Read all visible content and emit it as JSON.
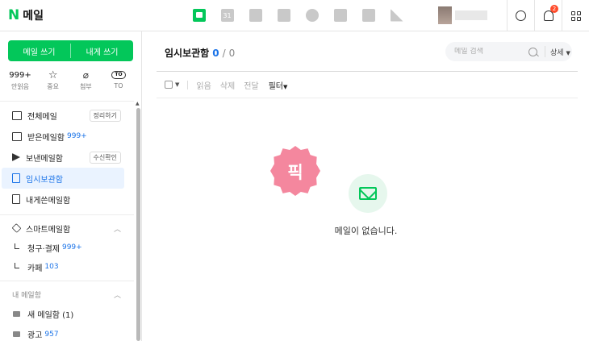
{
  "header": {
    "logo_letter": "N",
    "logo_text": "메일",
    "apps": [
      {
        "icon": "mail-icon",
        "active": true
      },
      {
        "icon": "calendar-icon",
        "label": "31"
      },
      {
        "icon": "photo-icon"
      },
      {
        "icon": "contacts-icon"
      },
      {
        "icon": "hexagon-icon"
      },
      {
        "icon": "memo-icon"
      },
      {
        "icon": "cafe-icon"
      },
      {
        "icon": "flag-icon"
      }
    ],
    "notification_count": "2",
    "accent_color": "#03c75a"
  },
  "sidebar": {
    "compose_label": "메일 쓰기",
    "self_compose_label": "내게 쓰기",
    "quick": [
      {
        "value": "999+",
        "label": "안읽음"
      },
      {
        "icon": "star-icon",
        "label": "중요"
      },
      {
        "icon": "paperclip-icon",
        "label": "첨부"
      },
      {
        "icon": "to-icon",
        "icon_text": "TO",
        "label": "TO"
      }
    ],
    "mailboxes": [
      {
        "label": "전체메일",
        "pill": "정리하기"
      },
      {
        "label": "받은메일함",
        "count": "999+"
      },
      {
        "label": "보낸메일함",
        "pill": "수신확인"
      },
      {
        "label": "임시보관함",
        "active": true
      },
      {
        "label": "내게쓴메일함"
      }
    ],
    "smart_section": "스마트메일함",
    "smart_items": [
      {
        "label": "청구·결제",
        "count": "999+"
      },
      {
        "label": "카페",
        "count": "103"
      }
    ],
    "my_section": "내 메일함",
    "folders": [
      {
        "label": "새 메일함 (1)"
      },
      {
        "label": "광고",
        "count": "957"
      }
    ]
  },
  "main": {
    "title": "임시보관함",
    "count_current": "0",
    "count_separator": "/",
    "count_total": "0",
    "search_placeholder": "메일 검색",
    "detail_label": "상세",
    "toolbar": {
      "read": "읽음",
      "delete": "삭제",
      "forward": "전달",
      "filter": "필터"
    },
    "pick_badge": "픽",
    "empty_message": "메일이 없습니다."
  }
}
